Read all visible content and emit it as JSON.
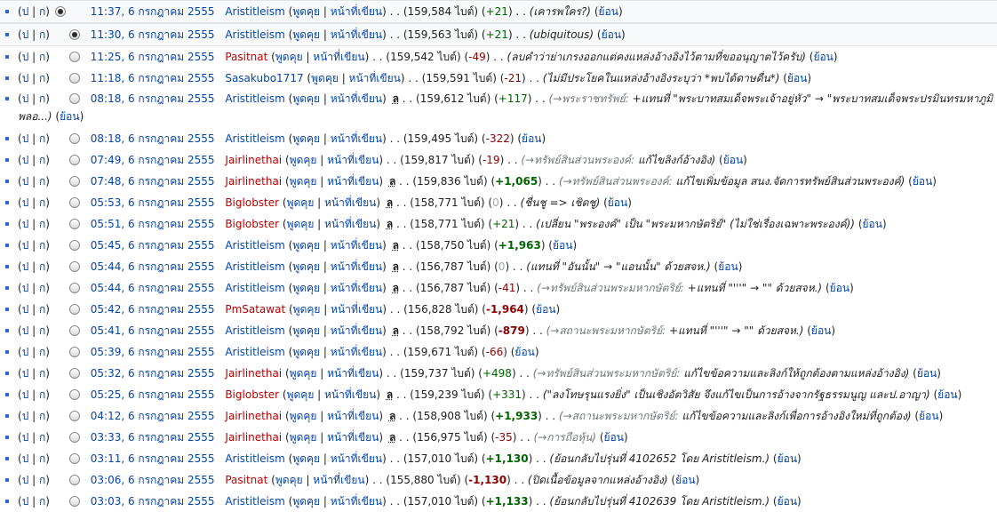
{
  "labels": {
    "cur": "ป",
    "last": "ก",
    "talk": "พูดคุย",
    "contribs": "หน้าที่เขียน",
    "bytes_unit": "ไบต์",
    "undo": "ย้อน",
    "minor": "ล"
  },
  "colors": {
    "link": "#0645ad",
    "new_link": "#ba0000",
    "positive": "#006400",
    "negative": "#8b0000",
    "zero": "#a2a9b1"
  },
  "revisions": [
    {
      "radio_left": "checked",
      "radio_right": "none",
      "timestamp": "11:37, 6 กรกฎาคม 2555",
      "user": "Aristitleism",
      "user_red": false,
      "minor": false,
      "bytes": "159,584",
      "diff": "+21",
      "diff_type": "pos",
      "diff_big": false,
      "autocomment": "",
      "comment": "(เคารพใคร?)"
    },
    {
      "radio_left": "none",
      "radio_right": "checked",
      "timestamp": "11:30, 6 กรกฎาคม 2555",
      "user": "Aristitleism",
      "user_red": false,
      "minor": false,
      "bytes": "159,563",
      "diff": "+21",
      "diff_type": "pos",
      "diff_big": false,
      "autocomment": "",
      "comment": "(ubiquitous)"
    },
    {
      "radio_left": "none",
      "radio_right": "empty",
      "timestamp": "11:25, 6 กรกฎาคม 2555",
      "user": "Pasitnat",
      "user_red": true,
      "minor": false,
      "bytes": "159,542",
      "diff": "-49",
      "diff_type": "neg",
      "diff_big": false,
      "autocomment": "",
      "comment": "(ลบคำว่าย่าเกรงออกแต่คงแหล่งอ้างอิงไว้ตามที่ขออนุญาตไว้ครับ)"
    },
    {
      "radio_left": "none",
      "radio_right": "empty",
      "timestamp": "11:18, 6 กรกฎาคม 2555",
      "user": "Sasakubo1717",
      "user_red": false,
      "minor": false,
      "bytes": "159,591",
      "diff": "-21",
      "diff_type": "neg",
      "diff_big": false,
      "autocomment": "",
      "comment": "(ไม่มีประโยคในแหล่งอ้างอิงระบุว่า *พบได้ดาษดื่น*)"
    },
    {
      "radio_left": "none",
      "radio_right": "empty",
      "timestamp": "08:18, 6 กรกฎาคม 2555",
      "user": "Aristitleism",
      "user_red": false,
      "minor": true,
      "bytes": "159,612",
      "diff": "+117",
      "diff_type": "pos",
      "diff_big": false,
      "autocomment": "(→พระราชทรัพย์:",
      "comment": "+แทนที่ \"พระบาทสมเด็จพระเจ้าอยู่หัว\" → \"พระบาทสมเด็จพระปรมินทรมหาภูมิพลอ...)",
      "wrap": true
    },
    {
      "radio_left": "none",
      "radio_right": "empty",
      "timestamp": "08:18, 6 กรกฎาคม 2555",
      "user": "Aristitleism",
      "user_red": false,
      "minor": false,
      "bytes": "159,495",
      "diff": "-322",
      "diff_type": "neg",
      "diff_big": false,
      "autocomment": "",
      "comment": ""
    },
    {
      "radio_left": "none",
      "radio_right": "empty",
      "timestamp": "07:49, 6 กรกฎาคม 2555",
      "user": "Jairlinethai",
      "user_red": true,
      "minor": false,
      "bytes": "159,817",
      "diff": "-19",
      "diff_type": "neg",
      "diff_big": false,
      "autocomment": "(→ทรัพย์สินส่วนพระองค์:",
      "comment": "แก้ไขลิงก์อ้างอิง)"
    },
    {
      "radio_left": "none",
      "radio_right": "empty",
      "timestamp": "07:48, 6 กรกฎาคม 2555",
      "user": "Jairlinethai",
      "user_red": true,
      "minor": true,
      "bytes": "159,836",
      "diff": "+1,065",
      "diff_type": "pos",
      "diff_big": true,
      "autocomment": "(→ทรัพย์สินส่วนพระองค์:",
      "comment": "แก้ไขเพิ่มข้อมูล สนง.จัดการทรัพย์สินส่วนพระองค์)"
    },
    {
      "radio_left": "none",
      "radio_right": "empty",
      "timestamp": "05:53, 6 กรกฎาคม 2555",
      "user": "Biglobster",
      "user_red": true,
      "minor": true,
      "bytes": "158,771",
      "diff": "0",
      "diff_type": "zero",
      "diff_big": false,
      "autocomment": "",
      "comment": "(ชื่นชู => เชิดชู)"
    },
    {
      "radio_left": "none",
      "radio_right": "empty",
      "timestamp": "05:51, 6 กรกฎาคม 2555",
      "user": "Biglobster",
      "user_red": true,
      "minor": true,
      "bytes": "158,771",
      "diff": "+21",
      "diff_type": "pos",
      "diff_big": false,
      "autocomment": "",
      "comment": "(เปลี่ยน \"พระองค์\" เป็น \"พระมหากษัตริย์\" (ไม่ใช่เรื่องเฉพาะพระองค์))"
    },
    {
      "radio_left": "none",
      "radio_right": "empty",
      "timestamp": "05:45, 6 กรกฎาคม 2555",
      "user": "Aristitleism",
      "user_red": false,
      "minor": true,
      "bytes": "158,750",
      "diff": "+1,963",
      "diff_type": "pos",
      "diff_big": true,
      "autocomment": "",
      "comment": ""
    },
    {
      "radio_left": "none",
      "radio_right": "empty",
      "timestamp": "05:44, 6 กรกฎาคม 2555",
      "user": "Aristitleism",
      "user_red": false,
      "minor": true,
      "bytes": "156,787",
      "diff": "0",
      "diff_type": "zero",
      "diff_big": false,
      "autocomment": "",
      "comment": "(แทนที่ \"อันนั้น\" → \"แอนนั้น\" ด้วยสจห.)"
    },
    {
      "radio_left": "none",
      "radio_right": "empty",
      "timestamp": "05:44, 6 กรกฎาคม 2555",
      "user": "Aristitleism",
      "user_red": false,
      "minor": true,
      "bytes": "156,787",
      "diff": "-41",
      "diff_type": "neg",
      "diff_big": false,
      "autocomment": "(→ทรัพย์สินส่วนพระมหากษัตริย์:",
      "comment": "+แทนที่ \"'''\" → \"\" ด้วยสจห.)"
    },
    {
      "radio_left": "none",
      "radio_right": "empty",
      "timestamp": "05:42, 6 กรกฎาคม 2555",
      "user": "PmSatawat",
      "user_red": true,
      "minor": false,
      "bytes": "156,828",
      "diff": "-1,964",
      "diff_type": "neg",
      "diff_big": true,
      "autocomment": "",
      "comment": ""
    },
    {
      "radio_left": "none",
      "radio_right": "empty",
      "timestamp": "05:41, 6 กรกฎาคม 2555",
      "user": "Aristitleism",
      "user_red": false,
      "minor": true,
      "bytes": "158,792",
      "diff": "-879",
      "diff_type": "neg",
      "diff_big": true,
      "autocomment": "(→สถานะพระมหากษัตริย์:",
      "comment": "+แทนที่ \"'''\" → \"\" ด้วยสจห.)"
    },
    {
      "radio_left": "none",
      "radio_right": "empty",
      "timestamp": "05:39, 6 กรกฎาคม 2555",
      "user": "Aristitleism",
      "user_red": false,
      "minor": false,
      "bytes": "159,671",
      "diff": "-66",
      "diff_type": "neg",
      "diff_big": false,
      "autocomment": "",
      "comment": ""
    },
    {
      "radio_left": "none",
      "radio_right": "empty",
      "timestamp": "05:32, 6 กรกฎาคม 2555",
      "user": "Jairlinethai",
      "user_red": true,
      "minor": false,
      "bytes": "159,737",
      "diff": "+498",
      "diff_type": "pos",
      "diff_big": false,
      "autocomment": "(→ทรัพย์สินส่วนพระมหากษัตริย์:",
      "comment": "แก้ไขข้อความและลิงก์ให้ถูกต้องตามแหล่งอ้างอิง)"
    },
    {
      "radio_left": "none",
      "radio_right": "empty",
      "timestamp": "05:25, 6 กรกฎาคม 2555",
      "user": "Biglobster",
      "user_red": true,
      "minor": true,
      "bytes": "159,239",
      "diff": "+331",
      "diff_type": "pos",
      "diff_big": false,
      "autocomment": "",
      "comment": "(\"ลงโทษรุนแรงยิ่ง\" เป็นเชิงอัตวิสัย จึงแก้ไขเป็นการอ้างจากรัฐธรรมนูญ และป.อาญา)"
    },
    {
      "radio_left": "none",
      "radio_right": "empty",
      "timestamp": "04:12, 6 กรกฎาคม 2555",
      "user": "Jairlinethai",
      "user_red": true,
      "minor": true,
      "bytes": "158,908",
      "diff": "+1,933",
      "diff_type": "pos",
      "diff_big": true,
      "autocomment": "(→สถานะพระมหากษัตริย์:",
      "comment": "แก้ไขข้อความและลิงก์เพื่อการอ้างอิงใหม่ที่ถูกต้อง)"
    },
    {
      "radio_left": "none",
      "radio_right": "empty",
      "timestamp": "03:33, 6 กรกฎาคม 2555",
      "user": "Jairlinethai",
      "user_red": true,
      "minor": true,
      "bytes": "156,975",
      "diff": "-35",
      "diff_type": "neg",
      "diff_big": false,
      "autocomment": "(→การถือหุ้น)",
      "comment": ""
    },
    {
      "radio_left": "none",
      "radio_right": "empty",
      "timestamp": "03:11, 6 กรกฎาคม 2555",
      "user": "Aristitleism",
      "user_red": false,
      "minor": false,
      "bytes": "157,010",
      "diff": "+1,130",
      "diff_type": "pos",
      "diff_big": true,
      "autocomment": "",
      "comment": "(ย้อนกลับไปรุ่นที่ 4102652 โดย Aristitleism.)"
    },
    {
      "radio_left": "none",
      "radio_right": "empty",
      "timestamp": "03:06, 6 กรกฎาคม 2555",
      "user": "Pasitnat",
      "user_red": true,
      "minor": false,
      "bytes": "155,880",
      "diff": "-1,130",
      "diff_type": "neg",
      "diff_big": true,
      "autocomment": "",
      "comment": "(ปิดเนื้อข้อมูลจากแหล่งอ้างอิง)"
    },
    {
      "radio_left": "none",
      "radio_right": "empty",
      "timestamp": "03:03, 6 กรกฎาคม 2555",
      "user": "Aristitleism",
      "user_red": false,
      "minor": false,
      "bytes": "157,010",
      "diff": "+1,133",
      "diff_type": "pos",
      "diff_big": true,
      "autocomment": "",
      "comment": "(ย้อนกลับไปรุ่นที่ 4102639 โดย Aristitleism.)"
    }
  ]
}
